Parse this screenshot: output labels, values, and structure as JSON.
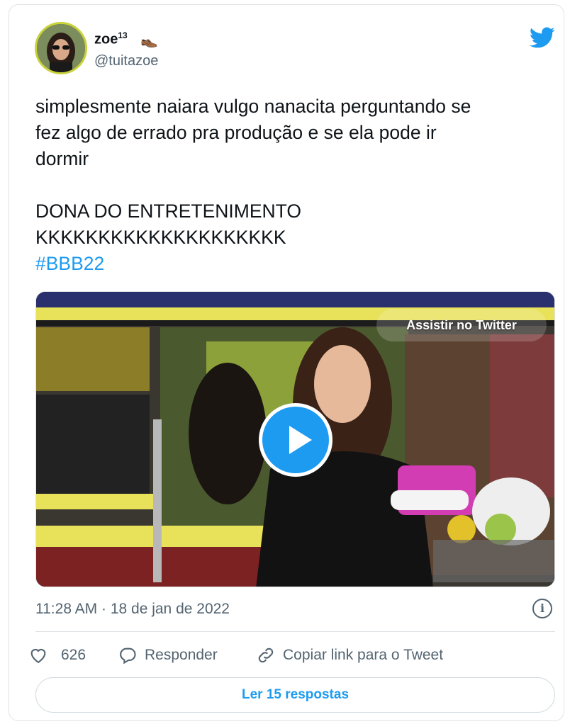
{
  "tweet": {
    "display_name": "zoe",
    "name_superscript": "13",
    "name_emoji": "👞",
    "handle": "@tuitazoe",
    "text_lines": [
      "simplesmente naiara vulgo nanacita perguntando se",
      "fez algo de errado pra produção e se ela pode ir",
      "dormir",
      "",
      "DONA DO ENTRETENIMENTO",
      "KKKKKKKKKKKKKKKKKKKK"
    ],
    "hashtag": "#BBB22",
    "timestamp": "11:28 AM · 18 de jan de 2022",
    "media": {
      "watch_label": "Assistir no Twitter",
      "play_icon": "play-icon"
    },
    "actions": {
      "like_count": "626",
      "reply_label": "Responder",
      "copy_label": "Copiar link para o Tweet"
    },
    "read_replies_label": "Ler 15 respostas"
  },
  "colors": {
    "accent": "#1d9bf0",
    "muted_text": "#536471",
    "border": "#dfe3e6"
  },
  "icons": [
    "twitter-bird-icon",
    "info-icon",
    "heart-icon",
    "reply-icon",
    "link-icon",
    "play-icon"
  ]
}
